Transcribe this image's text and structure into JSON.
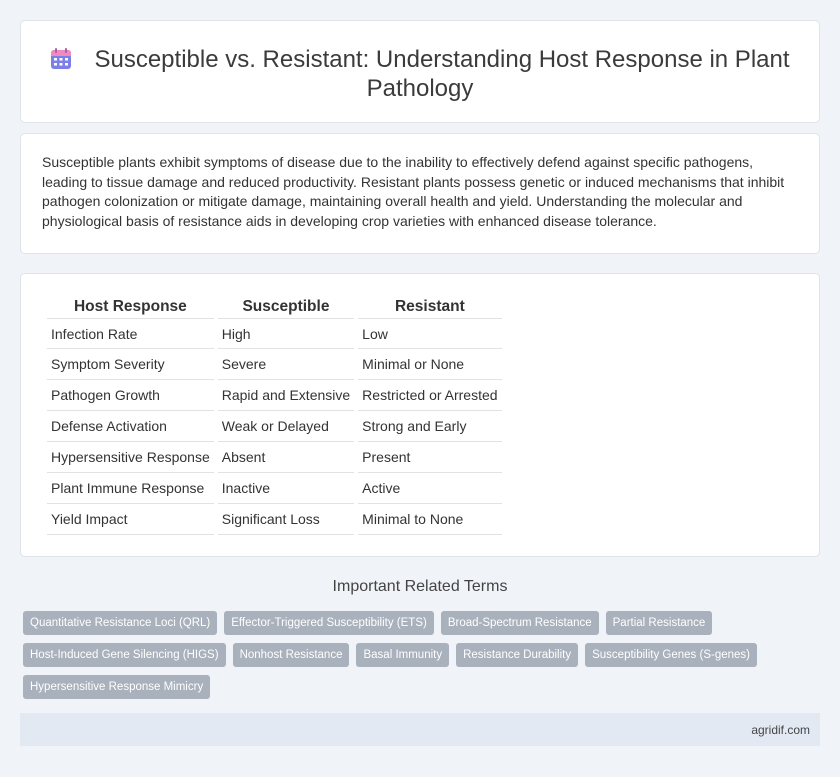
{
  "header": {
    "title": "Susceptible vs. Resistant: Understanding Host Response in Plant Pathology",
    "icon": "calendar-icon",
    "icon_colors": {
      "top": "#f08ac0",
      "body": "#7d7fe8"
    }
  },
  "intro": {
    "text": "Susceptible plants exhibit symptoms of disease due to the inability to effectively defend against specific pathogens, leading to tissue damage and reduced productivity. Resistant plants possess genetic or induced mechanisms that inhibit pathogen colonization or mitigate damage, maintaining overall health and yield. Understanding the molecular and physiological basis of resistance aids in developing crop varieties with enhanced disease tolerance."
  },
  "table": {
    "headers": [
      "Host Response",
      "Susceptible",
      "Resistant"
    ],
    "rows": [
      [
        "Infection Rate",
        "High",
        "Low"
      ],
      [
        "Symptom Severity",
        "Severe",
        "Minimal or None"
      ],
      [
        "Pathogen Growth",
        "Rapid and Extensive",
        "Restricted or Arrested"
      ],
      [
        "Defense Activation",
        "Weak or Delayed",
        "Strong and Early"
      ],
      [
        "Hypersensitive Response",
        "Absent",
        "Present"
      ],
      [
        "Plant Immune Response",
        "Inactive",
        "Active"
      ],
      [
        "Yield Impact",
        "Significant Loss",
        "Minimal to None"
      ]
    ]
  },
  "related": {
    "heading": "Important Related Terms",
    "tags": [
      "Quantitative Resistance Loci (QRL)",
      "Effector-Triggered Susceptibility (ETS)",
      "Broad-Spectrum Resistance",
      "Partial Resistance",
      "Host-Induced Gene Silencing (HIGS)",
      "Nonhost Resistance",
      "Basal Immunity",
      "Resistance Durability",
      "Susceptibility Genes (S-genes)",
      "Hypersensitive Response Mimicry"
    ]
  },
  "footer": {
    "site": "agridif.com"
  },
  "colors": {
    "tag_bg": "#a9b1bc",
    "footer_bg": "#e3e9f3",
    "page_bg": "#f0f3f8"
  }
}
